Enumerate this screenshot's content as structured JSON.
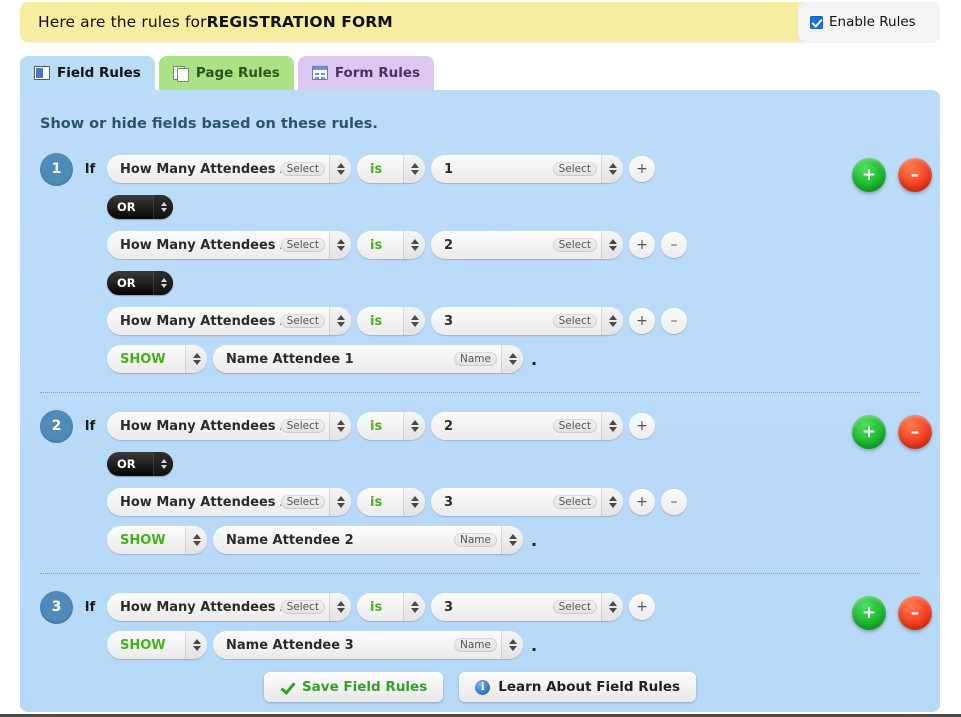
{
  "header": {
    "prefix": "Here are the rules for ",
    "form_name": "REGISTRATION FORM",
    "enable_label": "Enable Rules",
    "enable_checked": true,
    "bg_color": "#f7eda0"
  },
  "tabs": [
    {
      "label": "Field Rules",
      "icon": "field-rules-icon",
      "active": true,
      "color": "#b9dcf7"
    },
    {
      "label": "Page Rules",
      "icon": "page-rules-icon",
      "active": false,
      "color": "#abe285"
    },
    {
      "label": "Form Rules",
      "icon": "form-rules-icon",
      "active": false,
      "color": "#dcc7f2"
    }
  ],
  "panel": {
    "title": "Show or hide fields based on these rules.",
    "bg_color": "#bcdcf9",
    "accent_color": "#4f8ab8"
  },
  "labels": {
    "if": "If",
    "select_tag": "Select",
    "name_tag": "Name",
    "plus": "+",
    "minus": "–",
    "period": "."
  },
  "rules": [
    {
      "number": "1",
      "conditions": [
        {
          "connector": null,
          "field": "How Many Attendees Are",
          "field_tag": "Select",
          "operator": "is",
          "value": "1",
          "value_tag": "Select",
          "has_add": true,
          "has_remove": false
        },
        {
          "connector": "OR",
          "field": "How Many Attendees Are",
          "field_tag": "Select",
          "operator": "is",
          "value": "2",
          "value_tag": "Select",
          "has_add": true,
          "has_remove": true
        },
        {
          "connector": "OR",
          "field": "How Many Attendees Are",
          "field_tag": "Select",
          "operator": "is",
          "value": "3",
          "value_tag": "Select",
          "has_add": true,
          "has_remove": true
        }
      ],
      "action": "SHOW",
      "target_field": "Name Attendee 1",
      "target_tag": "Name"
    },
    {
      "number": "2",
      "conditions": [
        {
          "connector": null,
          "field": "How Many Attendees Are",
          "field_tag": "Select",
          "operator": "is",
          "value": "2",
          "value_tag": "Select",
          "has_add": true,
          "has_remove": false
        },
        {
          "connector": "OR",
          "field": "How Many Attendees Are",
          "field_tag": "Select",
          "operator": "is",
          "value": "3",
          "value_tag": "Select",
          "has_add": true,
          "has_remove": true
        }
      ],
      "action": "SHOW",
      "target_field": "Name Attendee 2",
      "target_tag": "Name"
    },
    {
      "number": "3",
      "conditions": [
        {
          "connector": null,
          "field": "How Many Attendees Are",
          "field_tag": "Select",
          "operator": "is",
          "value": "3",
          "value_tag": "Select",
          "has_add": true,
          "has_remove": false
        }
      ],
      "action": "SHOW",
      "target_field": "Name Attendee 3",
      "target_tag": "Name"
    }
  ],
  "footer": {
    "save_label": "Save Field Rules",
    "learn_label": "Learn About Field Rules",
    "info_glyph": "i"
  }
}
